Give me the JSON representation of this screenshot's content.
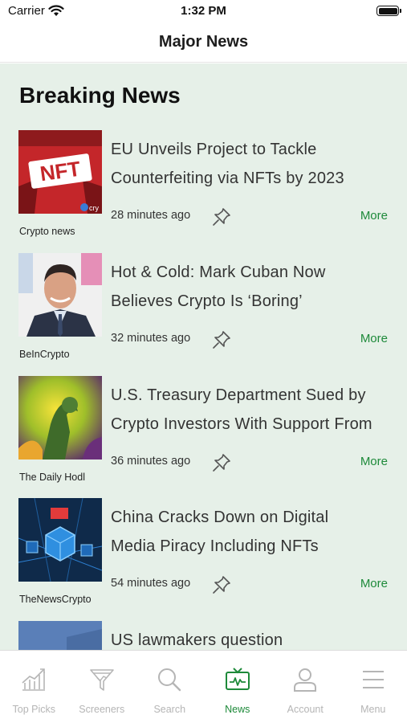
{
  "status_bar": {
    "carrier": "Carrier",
    "time": "1:32 PM"
  },
  "nav": {
    "title": "Major News"
  },
  "section": {
    "title": "Breaking News"
  },
  "news": [
    {
      "headline_line1": "EU Unveils Project to Tackle",
      "headline_line2": "Counterfeiting via NFTs by 2023",
      "time": "28 minutes ago",
      "source": "Crypto news",
      "more": "More",
      "thumb_text": "NFT"
    },
    {
      "headline_line1": "Hot & Cold: Mark Cuban Now",
      "headline_line2": "Believes Crypto Is ‘Boring’",
      "time": "32 minutes ago",
      "source": "BeInCrypto",
      "more": "More"
    },
    {
      "headline_line1": "U.S. Treasury Department Sued by",
      "headline_line2": "Crypto Investors With Support From",
      "time": "36 minutes ago",
      "source": "The Daily Hodl",
      "more": "More"
    },
    {
      "headline_line1": "China Cracks Down on Digital",
      "headline_line2": "Media Piracy Including NFTs",
      "time": "54 minutes ago",
      "source": "TheNewsCrypto",
      "more": "More"
    },
    {
      "headline_line1": "US lawmakers question",
      "headline_line2": ""
    }
  ],
  "tabs": [
    {
      "label": "Top Picks",
      "icon": "chart-icon"
    },
    {
      "label": "Screeners",
      "icon": "funnel-icon"
    },
    {
      "label": "Search",
      "icon": "search-icon"
    },
    {
      "label": "News",
      "icon": "tv-icon",
      "active": true
    },
    {
      "label": "Account",
      "icon": "user-icon"
    },
    {
      "label": "Menu",
      "icon": "menu-icon"
    }
  ],
  "colors": {
    "accent": "#1e8a3a",
    "content_bg": "#e6f0e8",
    "inactive_tab": "#b5b5b5"
  }
}
